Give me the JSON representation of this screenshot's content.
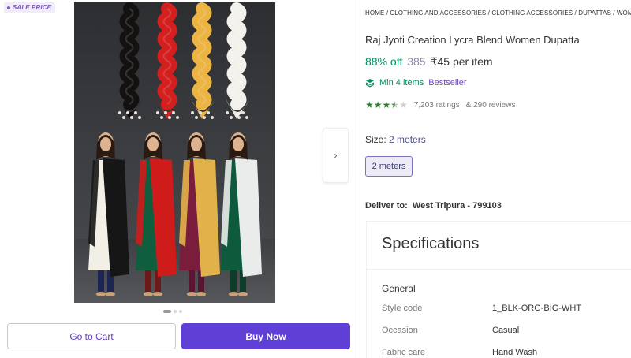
{
  "badge": {
    "label": "SALE PRICE"
  },
  "image": {
    "scarves": [
      {
        "color": "#141111"
      },
      {
        "color": "#d41f1f"
      },
      {
        "color": "#ecb442"
      },
      {
        "color": "#f3f1ec"
      }
    ],
    "models": [
      {
        "kurta": "#f2efe6",
        "dupatta": "#161616",
        "pants": "#1d2554"
      },
      {
        "kurta": "#0f5e3e",
        "dupatta": "#d01b1b",
        "pants": "#6b1a1a"
      },
      {
        "kurta": "#7a1d3d",
        "dupatta": "#e2b24a",
        "pants": "#5a1630"
      },
      {
        "kurta": "#0e5a3c",
        "dupatta": "#e9ecea",
        "pants": "#0e3d2c"
      }
    ]
  },
  "buttons": {
    "cart": "Go to Cart",
    "buy": "Buy Now"
  },
  "breadcrumb": "HOME / CLOTHING AND ACCESSORIES / CLOTHING ACCESSORIES / DUPATTAS / WOMEN",
  "product": {
    "title": "Raj Jyoti Creation Lycra Blend Women Dupatta",
    "discount": "88% off",
    "mrp": "385",
    "price": "₹45 per item",
    "min_items": "Min 4 items",
    "tag": "Bestseller",
    "rating_value": 3.5,
    "ratings": "7,203 ratings",
    "reviews": "& 290 reviews"
  },
  "size": {
    "label": "Size:",
    "value": "2 meters",
    "chip": "2 meters"
  },
  "delivery": {
    "label": "Deliver to:",
    "location": "West Tripura - 799103"
  },
  "specifications": {
    "title": "Specifications",
    "section": "General",
    "rows": [
      {
        "key": "Style code",
        "value": "1_BLK-ORG-BIG-WHT"
      },
      {
        "key": "Occasion",
        "value": "Casual"
      },
      {
        "key": "Fabric care",
        "value": "Hand Wash"
      }
    ]
  },
  "colors": {
    "accent": "#5f3fd6",
    "green": "#038d63",
    "purple_text": "#6a4ab5"
  }
}
